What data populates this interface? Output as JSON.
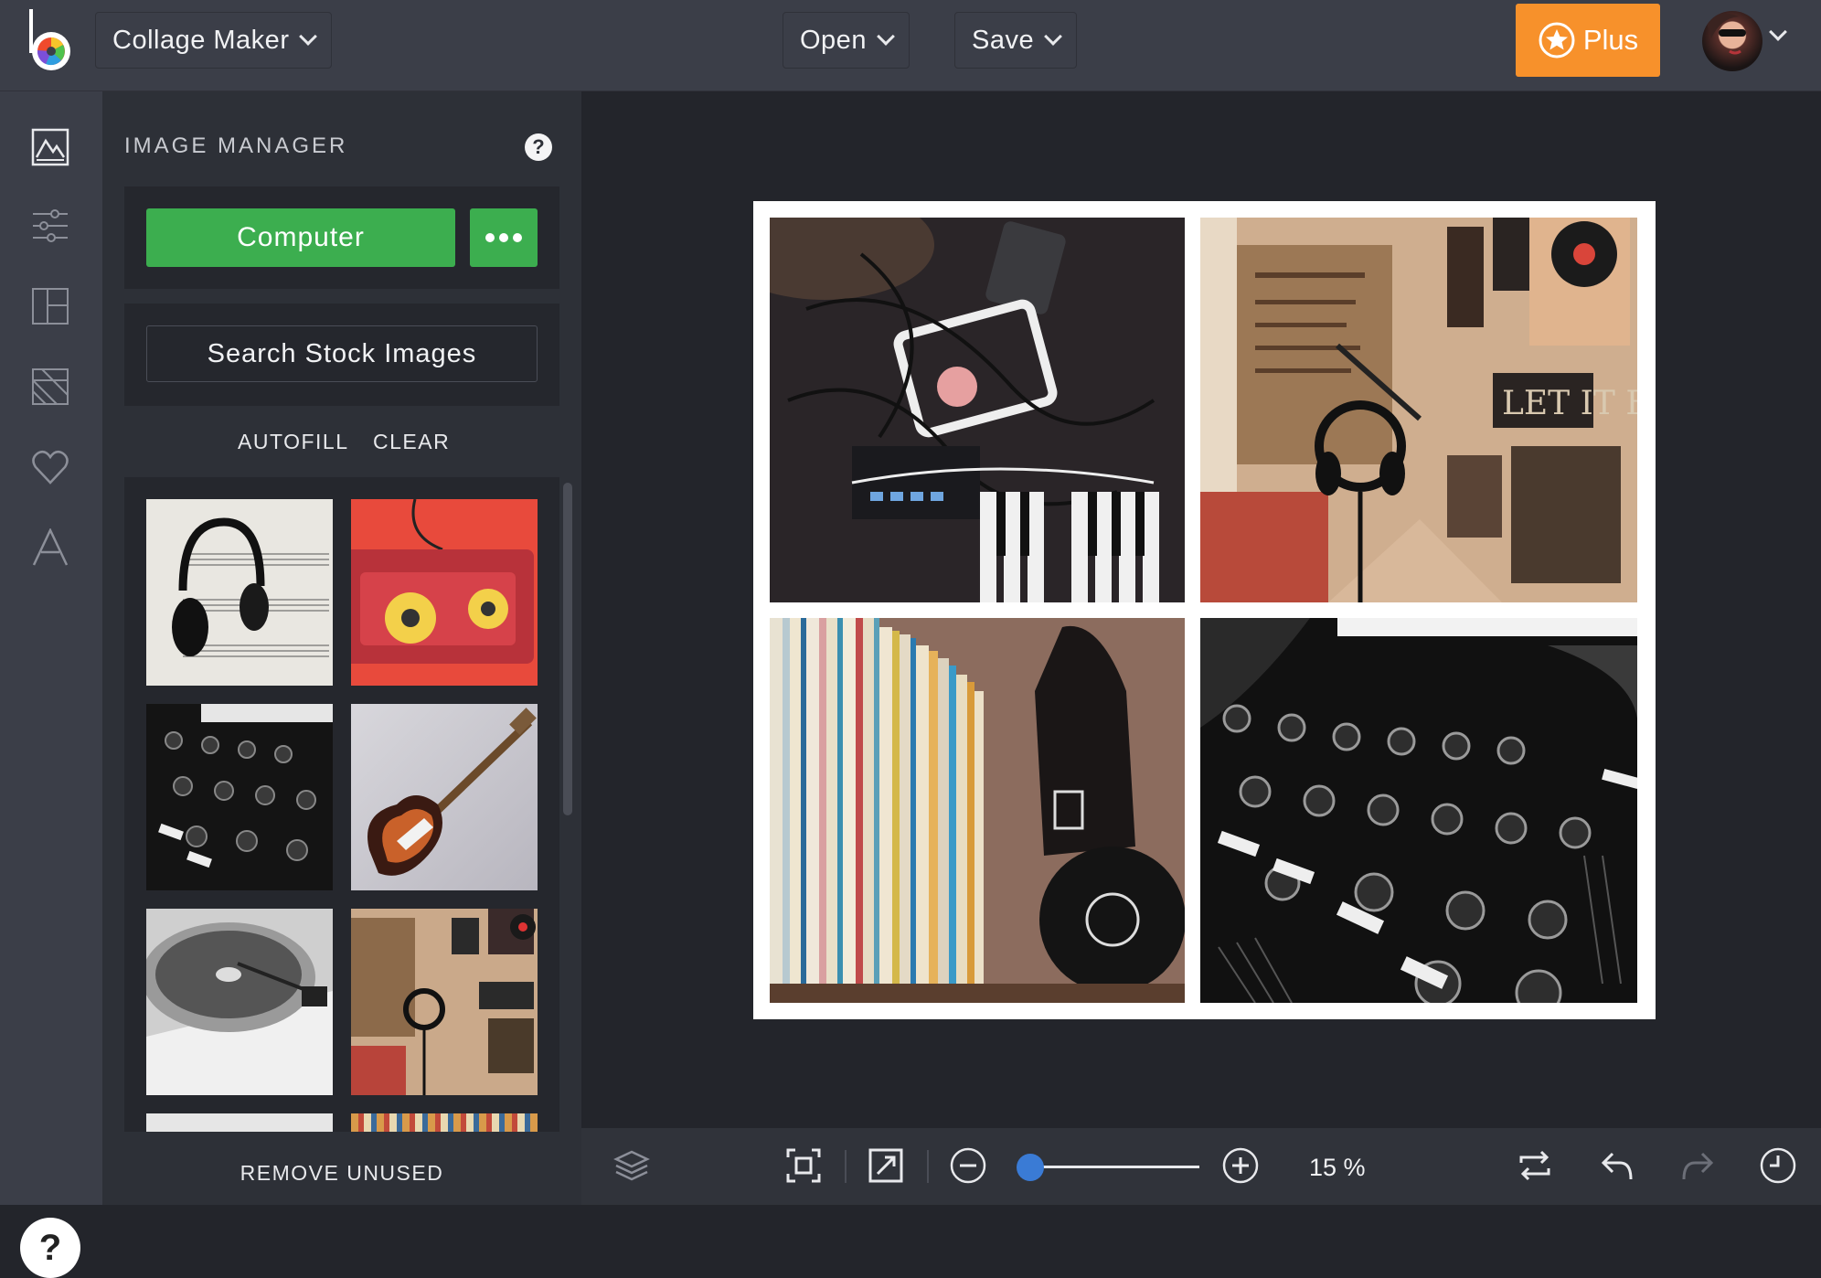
{
  "topbar": {
    "app_mode": "Collage Maker",
    "open_label": "Open",
    "save_label": "Save",
    "plus_label": "Plus"
  },
  "panel": {
    "title": "IMAGE MANAGER",
    "help_glyph": "?",
    "computer_label": "Computer",
    "search_stock_label": "Search Stock Images",
    "autofill_label": "AUTOFILL",
    "clear_label": "CLEAR",
    "remove_unused_label": "REMOVE UNUSED"
  },
  "thumbnails": [
    {
      "subject": "headphones on sheet music"
    },
    {
      "subject": "red cassette tape"
    },
    {
      "subject": "dj mixer black and white"
    },
    {
      "subject": "electric guitar"
    },
    {
      "subject": "record turntable"
    },
    {
      "subject": "room with microphone and posters"
    }
  ],
  "collage_cells": [
    {
      "subject": "cables and electronics"
    },
    {
      "subject": "studio microphone and posters"
    },
    {
      "subject": "vinyl records and headphones"
    },
    {
      "subject": "dj mixer"
    }
  ],
  "footer": {
    "help_glyph": "?",
    "zoom_label": "15 %",
    "zoom_level": 0.05
  },
  "colors": {
    "accent_green": "#3cae4f",
    "plus_orange": "#f7912b",
    "slider_blue": "#3a7bd5"
  },
  "icons": [
    "image-icon",
    "adjust-sliders-icon",
    "layout-icon",
    "background-icon",
    "heart-icon",
    "text-icon",
    "layers-icon",
    "fit-icon",
    "resize-icon",
    "zoom-out-icon",
    "zoom-in-icon",
    "swap-icon",
    "undo-icon",
    "redo-icon",
    "history-icon"
  ]
}
